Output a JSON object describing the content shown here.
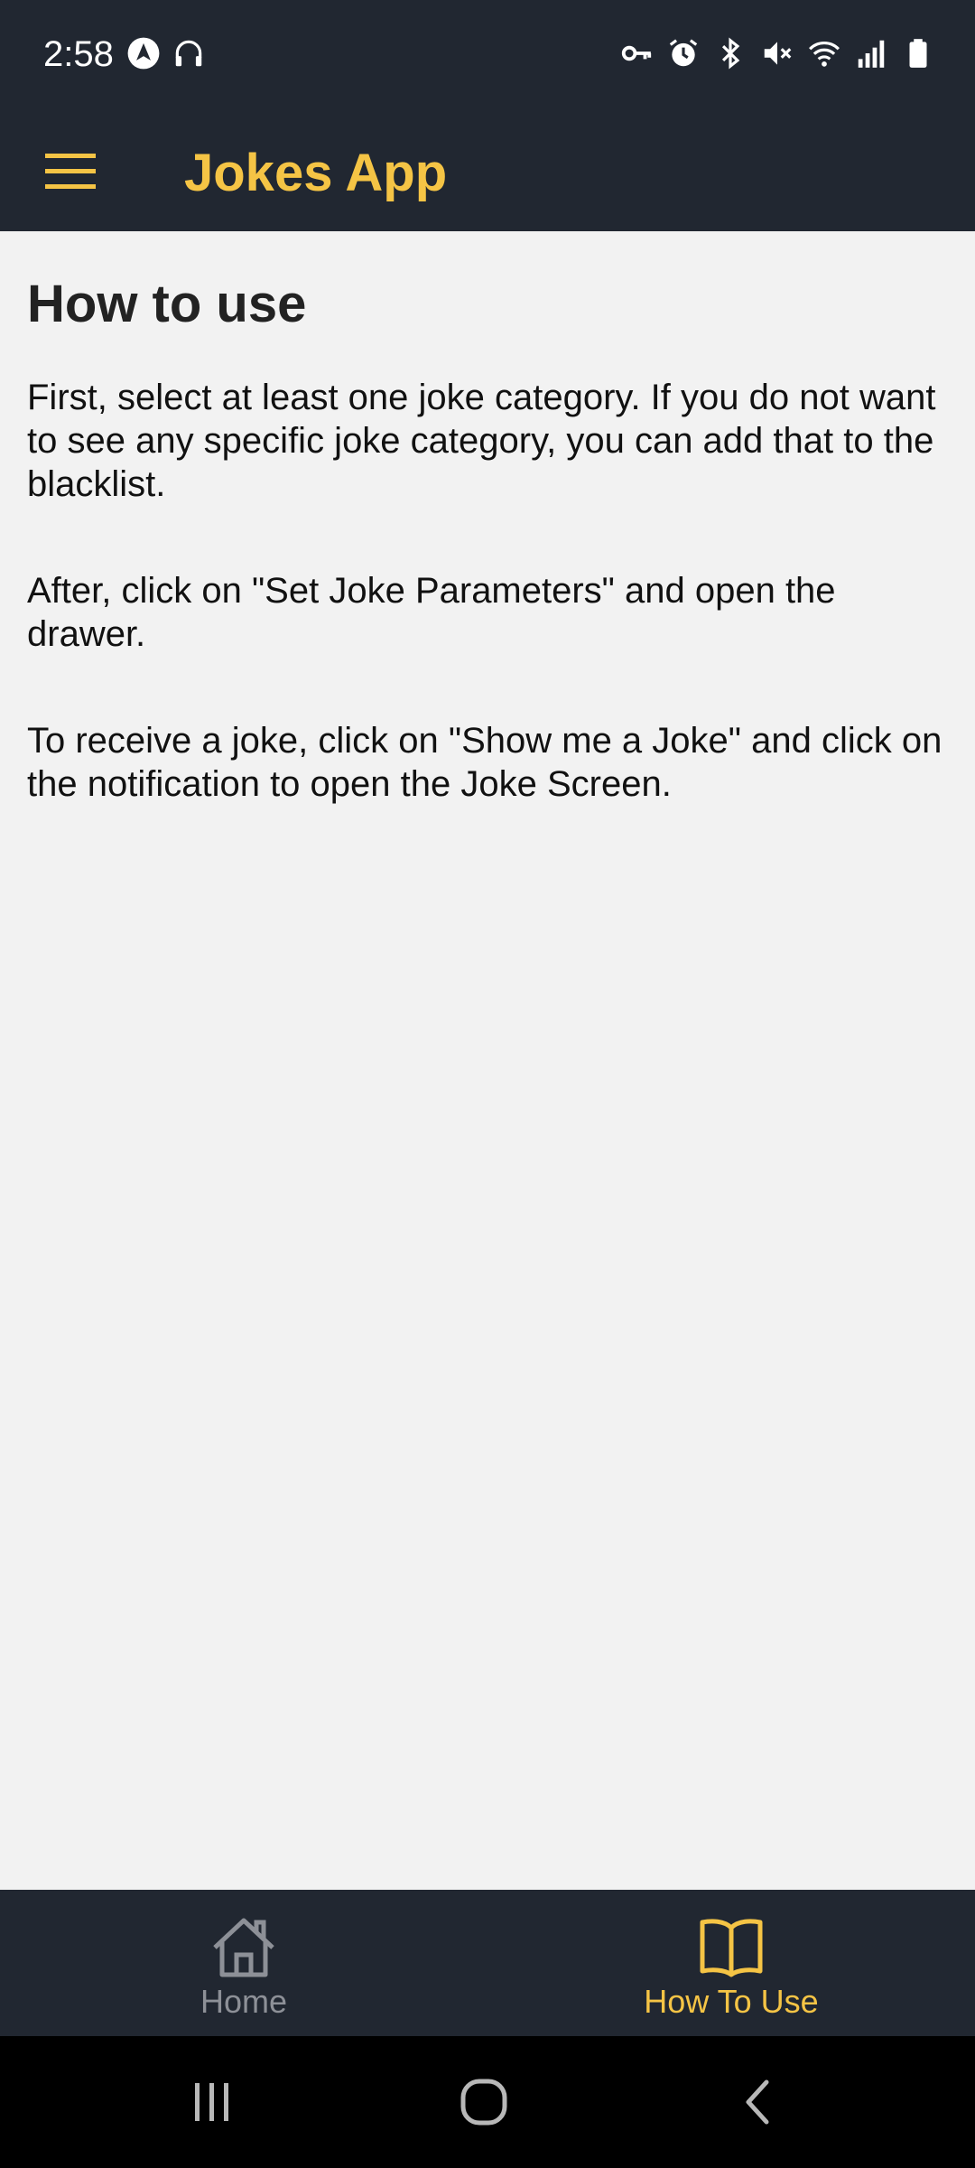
{
  "status_bar": {
    "time": "2:58",
    "left_icons": [
      "navigation-app-icon",
      "headphones-icon"
    ],
    "right_icons": [
      "vpn-key-icon",
      "alarm-icon",
      "bluetooth-icon",
      "mute-icon",
      "wifi-icon",
      "signal-icon",
      "battery-icon"
    ]
  },
  "app_bar": {
    "title": "Jokes App",
    "menu_icon": "hamburger-menu-icon"
  },
  "content": {
    "heading": "How to use",
    "paragraphs": [
      "First, select at least one joke category. If you do not want to see any specific joke category, you can add that to the blacklist.",
      "After, click on \"Set Joke Parameters\" and open the drawer.",
      "To receive a joke, click on \"Show me a Joke\" and click on the notification to open the Joke Screen."
    ]
  },
  "bottom_nav": {
    "tabs": [
      {
        "label": "Home",
        "icon": "home-icon",
        "selected": false
      },
      {
        "label": "How To Use",
        "icon": "book-icon",
        "selected": true
      }
    ]
  },
  "system_nav": {
    "buttons": [
      "recent-apps-icon",
      "home-circle-icon",
      "back-icon"
    ]
  },
  "colors": {
    "bar_background": "#212731",
    "accent": "#f5c445",
    "content_background": "#f2f2f2",
    "inactive_tab": "#8d9097"
  }
}
